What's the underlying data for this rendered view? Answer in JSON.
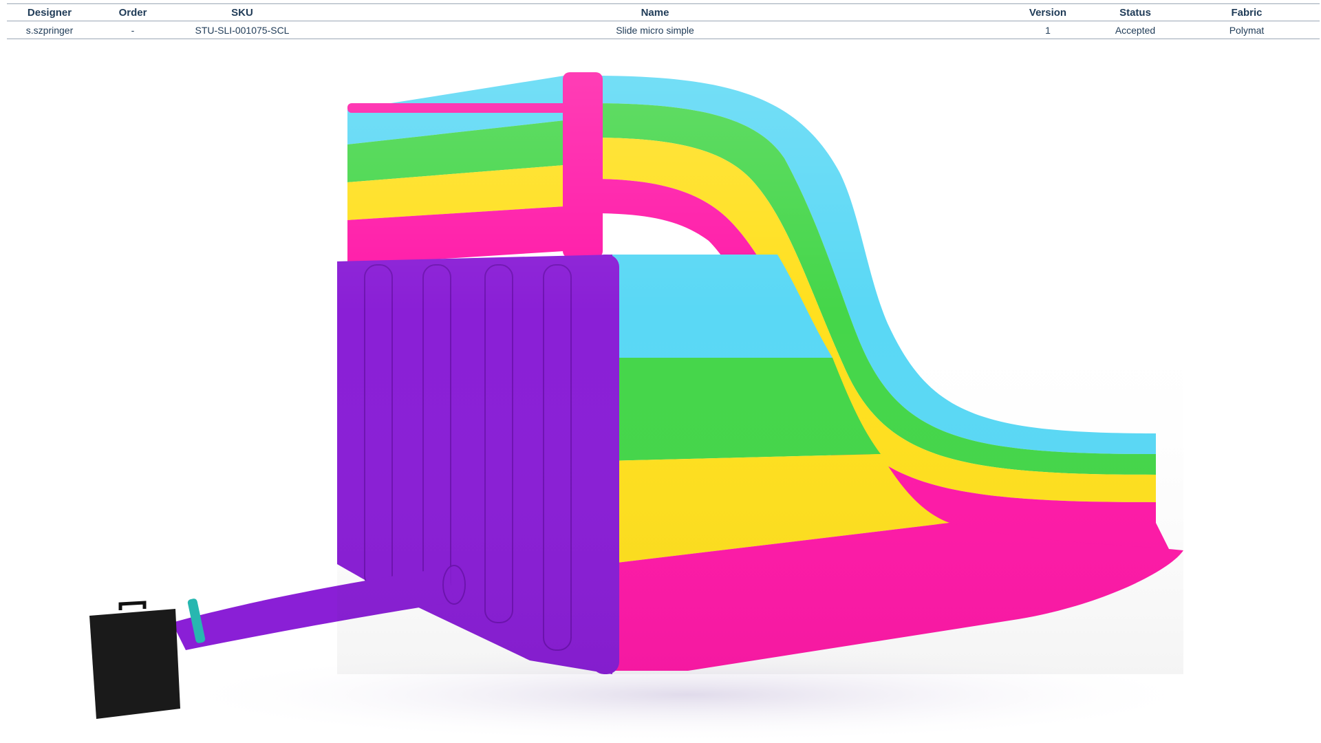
{
  "table": {
    "headers": [
      "Designer",
      "Order",
      "SKU",
      "Name",
      "Version",
      "Status",
      "Fabric"
    ],
    "row": {
      "designer": "s.szpringer",
      "order": "-",
      "sku": "STU-SLI-001075-SCL",
      "name": "Slide micro simple",
      "version": "1",
      "status": "Accepted",
      "fabric": "Polymat"
    }
  },
  "render": {
    "subject": "inflatable-slide",
    "colors": {
      "pink": "#ff1aa8",
      "blue": "#5ad8f5",
      "green": "#45d64a",
      "yellow": "#ffe01f",
      "purple": "#8a1fd6",
      "blower": "#1a1a1a"
    }
  }
}
